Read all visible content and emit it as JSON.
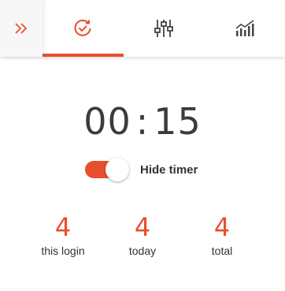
{
  "colors": {
    "accent": "#e94e2e",
    "text": "#333333",
    "timer_text": "#3b3b3b",
    "icon": "#444444"
  },
  "tabbar": {
    "collapse_icon": "double-chevron-right-icon",
    "tabs": [
      {
        "icon": "timer-refresh-icon",
        "active": true
      },
      {
        "icon": "sliders-icon",
        "active": false
      },
      {
        "icon": "trend-chart-icon",
        "active": false
      }
    ]
  },
  "timer": {
    "minutes": "00",
    "separator": ":",
    "seconds": "15"
  },
  "hide_timer": {
    "label": "Hide timer",
    "enabled": true
  },
  "stats": [
    {
      "value": "4",
      "label": "this login"
    },
    {
      "value": "4",
      "label": "today"
    },
    {
      "value": "4",
      "label": "total"
    }
  ]
}
